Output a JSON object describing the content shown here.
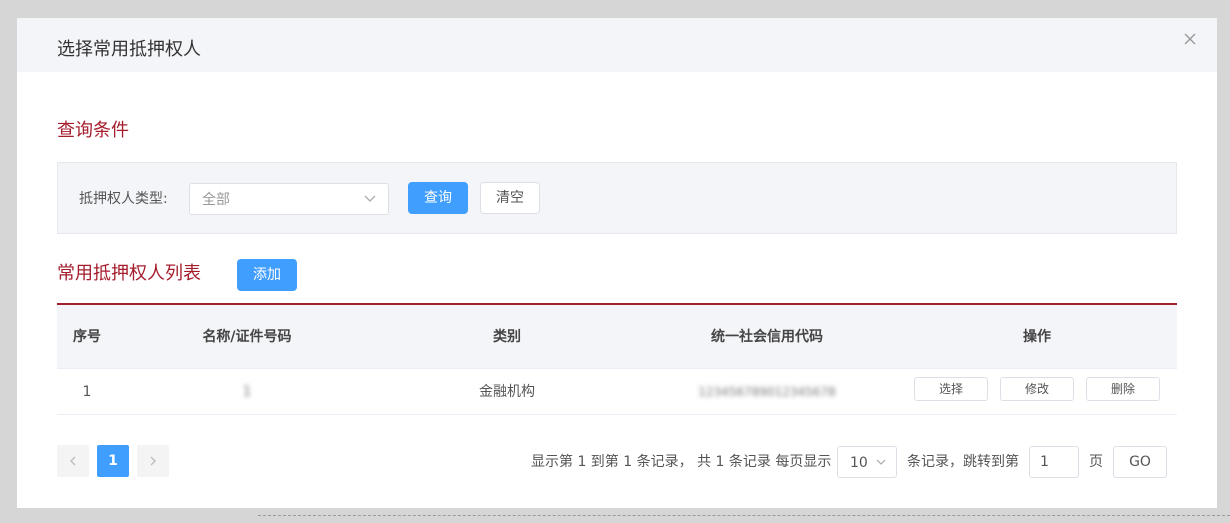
{
  "dialog": {
    "title": "选择常用抵押权人"
  },
  "query": {
    "section_title": "查询条件",
    "type_label": "抵押权人类型:",
    "type_value": "全部",
    "search_label": "查询",
    "clear_label": "清空"
  },
  "list": {
    "section_title": "常用抵押权人列表",
    "add_label": "添加",
    "columns": [
      "序号",
      "名称/证件号码",
      "类别",
      "统一社会信用代码",
      "操作"
    ],
    "rows": [
      {
        "index": "1",
        "name": "1",
        "category": "金融机构",
        "credit_code": "123456789012345678",
        "actions": [
          "选择",
          "修改",
          "删除"
        ]
      }
    ]
  },
  "pagination": {
    "prev_icon": "chevron-left-icon",
    "current_page": "1",
    "next_icon": "chevron-right-icon",
    "summary": "显示第 1 到第 1 条记录， 共 1 条记录 每页显示",
    "page_size": "10",
    "jump_prefix": "条记录，跳转到第",
    "jump_value": "1",
    "jump_suffix": "页",
    "go_label": "GO"
  },
  "colors": {
    "primary": "#409eff",
    "accent": "#a51d2d"
  }
}
